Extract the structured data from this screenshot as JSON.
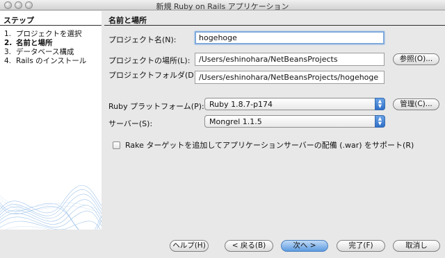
{
  "window": {
    "title": "新規 Ruby on Rails アプリケーション"
  },
  "steps": {
    "header": "ステップ",
    "items": [
      {
        "num": "1.",
        "label": "プロジェクトを選択"
      },
      {
        "num": "2.",
        "label": "名前と場所"
      },
      {
        "num": "3.",
        "label": "データベース構成"
      },
      {
        "num": "4.",
        "label": "Rails のインストール"
      }
    ],
    "current_index": 1
  },
  "main": {
    "section_title": "名前と場所",
    "project_name": {
      "label": "プロジェクト名(N):",
      "value": "hogehoge"
    },
    "project_location": {
      "label": "プロジェクトの場所(L):",
      "value": "/Users/eshinohara/NetBeansProjects",
      "browse_label": "参照(O)..."
    },
    "project_folder": {
      "label": "プロジェクトフォルダ(D):",
      "value": "/Users/eshinohara/NetBeansProjects/hogehoge"
    },
    "ruby_platform": {
      "label": "Ruby プラットフォーム(P):",
      "value": "Ruby 1.8.7-p174",
      "manage_label": "管理(C)..."
    },
    "server": {
      "label": "サーバー(S):",
      "value": "Mongrel 1.1.5"
    },
    "rake_checkbox": {
      "label": "Rake ターゲットを追加してアプリケーションサーバーの配備 (.war) をサポート(R)",
      "checked": false
    }
  },
  "buttons": {
    "help": "ヘルプ(H)",
    "back": "< 戻る(B)",
    "next": "次へ >",
    "finish": "完了(F)",
    "cancel": "取消し"
  }
}
